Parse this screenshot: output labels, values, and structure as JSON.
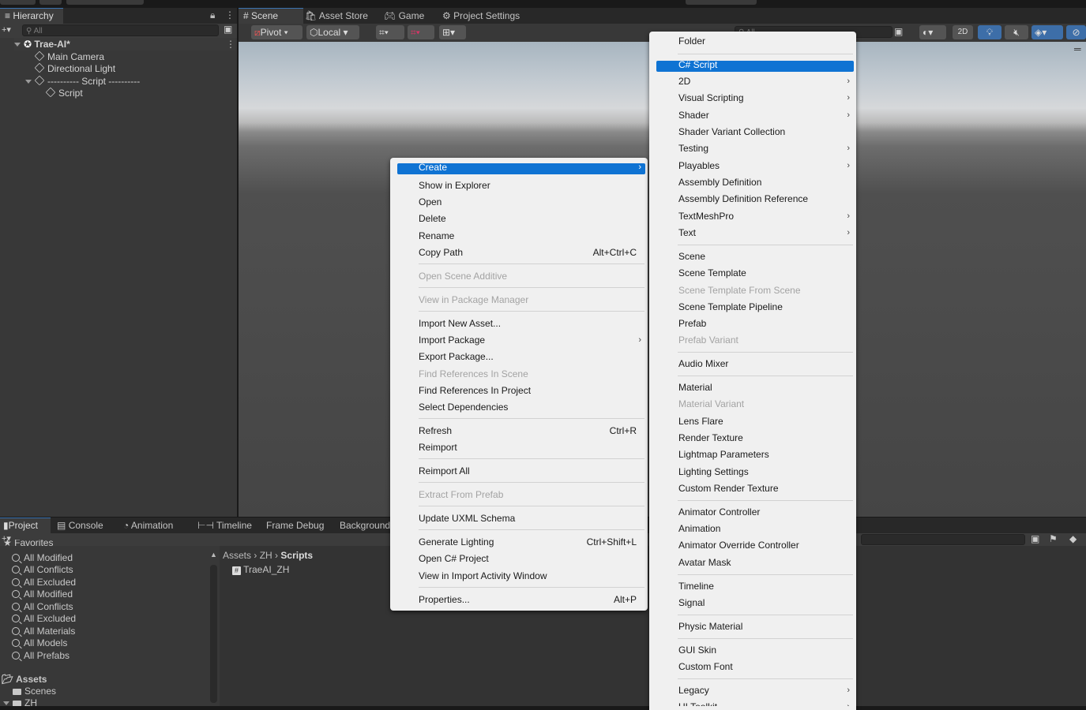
{
  "hierarchy": {
    "tab_label": "Hierarchy",
    "search_placeholder": "All",
    "items": [
      {
        "label": "Trae-AI*"
      },
      {
        "label": "Main Camera"
      },
      {
        "label": "Directional Light"
      },
      {
        "label": "---------- Script ----------"
      },
      {
        "label": "Script"
      }
    ]
  },
  "scene": {
    "tabs": [
      {
        "label": "Scene"
      },
      {
        "label": "Asset Store"
      },
      {
        "label": "Game"
      },
      {
        "label": "Project Settings"
      }
    ],
    "toolbar": {
      "pivot": "Pivot",
      "local": "Local",
      "mode_2d": "2D",
      "search_placeholder": "All"
    }
  },
  "bottom": {
    "tabs": [
      {
        "label": "Project"
      },
      {
        "label": "Console"
      },
      {
        "label": "Animation"
      },
      {
        "label": "Timeline"
      },
      {
        "label": "Frame Debug"
      },
      {
        "label": "Background"
      }
    ],
    "favorites_header": "Favorites",
    "favorites": [
      "All Modified",
      "All Conflicts",
      "All Excluded",
      "All Modified",
      "All Conflicts",
      "All Excluded",
      "All Materials",
      "All Models",
      "All Prefabs"
    ],
    "assets_label": "Assets",
    "folders": [
      "Scenes",
      "ZH"
    ],
    "breadcrumb": [
      "Assets",
      "ZH",
      "Scripts"
    ],
    "files": [
      "TraeAI_ZH"
    ]
  },
  "context_menu": {
    "items": [
      {
        "label": "Create",
        "submenu": true,
        "highlight": true
      },
      {
        "label": "Show in Explorer"
      },
      {
        "label": "Open"
      },
      {
        "label": "Delete"
      },
      {
        "label": "Rename"
      },
      {
        "label": "Copy Path",
        "shortcut": "Alt+Ctrl+C"
      },
      {
        "label": "Open Scene Additive",
        "disabled": true
      },
      {
        "label": "View in Package Manager",
        "disabled": true
      },
      {
        "label": "Import New Asset..."
      },
      {
        "label": "Import Package",
        "submenu": true
      },
      {
        "label": "Export Package..."
      },
      {
        "label": "Find References In Scene",
        "disabled": true
      },
      {
        "label": "Find References In Project"
      },
      {
        "label": "Select Dependencies"
      },
      {
        "label": "Refresh",
        "shortcut": "Ctrl+R"
      },
      {
        "label": "Reimport"
      },
      {
        "label": "Reimport All"
      },
      {
        "label": "Extract From Prefab",
        "disabled": true
      },
      {
        "label": "Update UXML Schema"
      },
      {
        "label": "Generate Lighting",
        "shortcut": "Ctrl+Shift+L"
      },
      {
        "label": "Open C# Project"
      },
      {
        "label": "View in Import Activity Window"
      },
      {
        "label": "Properties...",
        "shortcut": "Alt+P"
      }
    ]
  },
  "create_menu": {
    "items": [
      {
        "label": "Folder"
      },
      {
        "label": "C# Script",
        "highlight": true
      },
      {
        "label": "2D",
        "submenu": true
      },
      {
        "label": "Visual Scripting",
        "submenu": true
      },
      {
        "label": "Shader",
        "submenu": true
      },
      {
        "label": "Shader Variant Collection"
      },
      {
        "label": "Testing",
        "submenu": true
      },
      {
        "label": "Playables",
        "submenu": true
      },
      {
        "label": "Assembly Definition"
      },
      {
        "label": "Assembly Definition Reference"
      },
      {
        "label": "TextMeshPro",
        "submenu": true
      },
      {
        "label": "Text",
        "submenu": true
      },
      {
        "label": "Scene"
      },
      {
        "label": "Scene Template"
      },
      {
        "label": "Scene Template From Scene",
        "disabled": true
      },
      {
        "label": "Scene Template Pipeline"
      },
      {
        "label": "Prefab"
      },
      {
        "label": "Prefab Variant",
        "disabled": true
      },
      {
        "label": "Audio Mixer"
      },
      {
        "label": "Material"
      },
      {
        "label": "Material Variant",
        "disabled": true
      },
      {
        "label": "Lens Flare"
      },
      {
        "label": "Render Texture"
      },
      {
        "label": "Lightmap Parameters"
      },
      {
        "label": "Lighting Settings"
      },
      {
        "label": "Custom Render Texture"
      },
      {
        "label": "Animator Controller"
      },
      {
        "label": "Animation"
      },
      {
        "label": "Animator Override Controller"
      },
      {
        "label": "Avatar Mask"
      },
      {
        "label": "Timeline"
      },
      {
        "label": "Signal"
      },
      {
        "label": "Physic Material"
      },
      {
        "label": "GUI Skin"
      },
      {
        "label": "Custom Font"
      },
      {
        "label": "Legacy",
        "submenu": true
      },
      {
        "label": "UI Toolkit",
        "submenu": true
      }
    ]
  },
  "colors": {
    "accent": "#0f73d3",
    "panel": "#383838",
    "menu_bg": "#f0f0f0"
  }
}
